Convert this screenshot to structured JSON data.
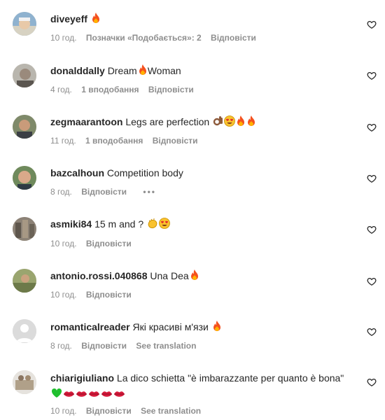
{
  "comments": [
    {
      "username": "diveyeff",
      "text": "",
      "emojis": [
        "fire"
      ],
      "time": "10 год.",
      "likes": "Позначки «Подобається»: 2",
      "reply": "Відповісти",
      "extra": ""
    },
    {
      "username": "donalddally",
      "text": "Dream",
      "emojis": [
        "fire"
      ],
      "text_after": "Woman",
      "time": "4 год.",
      "likes": "1 вподобання",
      "reply": "Відповісти",
      "extra": ""
    },
    {
      "username": "zegmaarantoon",
      "text": "Legs are perfection",
      "emojis": [
        "ok-hand",
        "heart-eyes",
        "fire",
        "fire"
      ],
      "time": "11 год.",
      "likes": "1 вподобання",
      "reply": "Відповісти",
      "extra": ""
    },
    {
      "username": "bazcalhoun",
      "text": "Competition body",
      "emojis": [],
      "time": "8 год.",
      "likes": "",
      "reply": "Відповісти",
      "extra": "•••"
    },
    {
      "username": "asmiki84",
      "text": "15 m and ?",
      "emojis": [
        "clap",
        "heart-eyes"
      ],
      "time": "10 год.",
      "likes": "",
      "reply": "Відповісти",
      "extra": ""
    },
    {
      "username": "antonio.rossi.040868",
      "text": "Una Dea",
      "emojis": [
        "fire"
      ],
      "time": "10 год.",
      "likes": "",
      "reply": "Відповісти",
      "extra": ""
    },
    {
      "username": "romanticalreader",
      "text": "Які красиві м'язи",
      "emojis": [
        "fire"
      ],
      "time": "8 год.",
      "likes": "",
      "reply": "Відповісти",
      "extra": "See translation"
    },
    {
      "username": "chiarigiuliano",
      "text": "La dico schietta \"è imbarazzante per quanto è bona\"",
      "emojis": [
        "green-heart",
        "lips",
        "lips",
        "lips",
        "lips",
        "lips"
      ],
      "time": "10 год.",
      "likes": "",
      "reply": "Відповісти",
      "extra": "See translation"
    }
  ],
  "icons": {
    "like": "heart-outline-icon"
  },
  "colors": {
    "text": "#262626",
    "meta": "#8e8e8e",
    "fire": "#f4511e"
  }
}
